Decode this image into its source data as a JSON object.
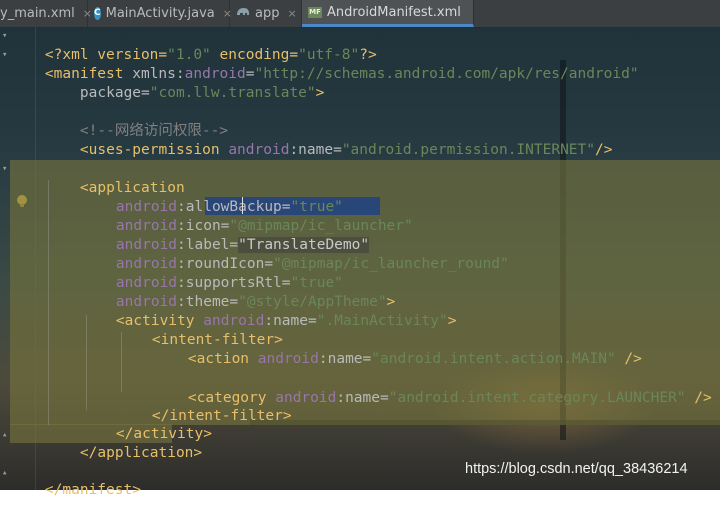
{
  "tabs": [
    {
      "label": "y_main.xml",
      "icon": "xml-file-icon",
      "active": false
    },
    {
      "label": "MainActivity.java",
      "icon": "java-class-icon",
      "active": false
    },
    {
      "label": "app",
      "icon": "gradle-elephant-icon",
      "active": false
    },
    {
      "label": "AndroidManifest.xml",
      "icon": "manifest-file-icon",
      "active": true
    }
  ],
  "tab_close": "×",
  "icon_badges": {
    "java_class": "C",
    "manifest": "MF"
  },
  "code": {
    "l1": {
      "a": "<?xml version=",
      "b": "\"1.0\"",
      "c": " encoding=",
      "d": "\"utf-8\"",
      "e": "?>"
    },
    "l2": {
      "a": "<manifest ",
      "b": "xmlns:",
      "c": "android",
      "d": "=",
      "e": "\"http://schemas.android.com/apk/res/android\""
    },
    "l3": {
      "a": "package=",
      "b": "\"com.llw.translate\"",
      "c": ">"
    },
    "l4": {
      "a": "<!--网络访问权限-->"
    },
    "l5": {
      "a": "<uses-permission ",
      "b": "android",
      "c": ":name=",
      "d": "\"android.permission.INTERNET\"",
      "e": "/>"
    },
    "l6": {
      "a": "<application"
    },
    "l7": {
      "a": "android",
      "b": ":allowBackup=",
      "c": "\"true\""
    },
    "l8": {
      "a": "android",
      "b": ":icon=",
      "c": "\"@mipmap/ic_launcher\""
    },
    "l9": {
      "a": "android",
      "b": ":label=",
      "c": "\"TranslateDemo\""
    },
    "l10": {
      "a": "android",
      "b": ":roundIcon=",
      "c": "\"@mipmap/ic_launcher_round\""
    },
    "l11": {
      "a": "android",
      "b": ":supportsRtl=",
      "c": "\"true\""
    },
    "l12": {
      "a": "android",
      "b": ":theme=",
      "c": "\"@style/AppTheme\"",
      "d": ">"
    },
    "l13": {
      "a": "<activity ",
      "b": "android",
      "c": ":name=",
      "d": "\".MainActivity\"",
      "e": ">"
    },
    "l14": {
      "a": "<intent-filter>"
    },
    "l15": {
      "a": "<action ",
      "b": "android",
      "c": ":name=",
      "d": "\"android.intent.action.MAIN\"",
      "e": " />"
    },
    "l16": {
      "a": "<category ",
      "b": "android",
      "c": ":name=",
      "d": "\"android.intent.category.LAUNCHER\"",
      "e": " />"
    },
    "l17": {
      "a": "</intent-filter>"
    },
    "l18": {
      "a": "</activity>"
    },
    "l19": {
      "a": "</application>"
    },
    "l20": {
      "a": "</manifest>"
    }
  },
  "watermark": "https://blog.csdn.net/qq_38436214",
  "colors": {
    "tag": "#e8bf6a",
    "namespace": "#9876aa",
    "attribute": "#bababa",
    "value": "#6a8759",
    "comment": "#808080",
    "accent": "#4a88c7"
  }
}
